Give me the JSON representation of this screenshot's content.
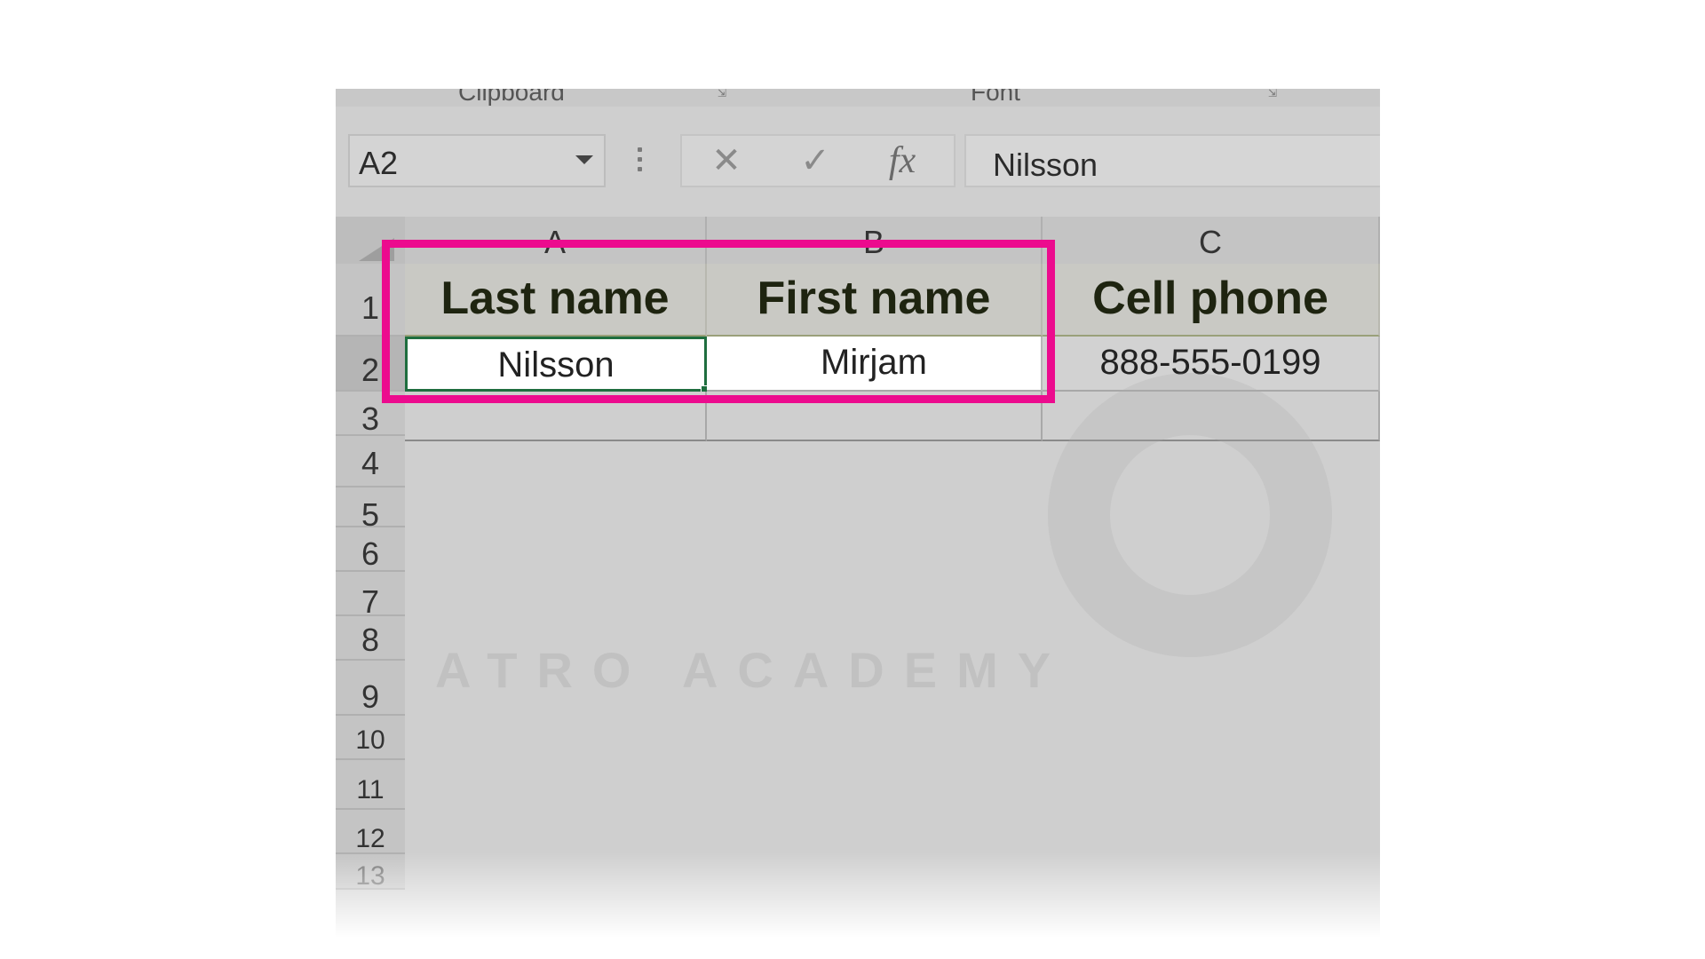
{
  "ribbon": {
    "groups": [
      {
        "label": "Clipboard"
      },
      {
        "label": "Font"
      }
    ]
  },
  "formula_bar": {
    "name_box": "A2",
    "cancel_glyph": "✕",
    "enter_glyph": "✓",
    "fx_label": "fx",
    "value": "Nilsson"
  },
  "sheet": {
    "columns": [
      "A",
      "B",
      "C"
    ],
    "rows": [
      "1",
      "2",
      "3",
      "4",
      "5",
      "6",
      "7",
      "8",
      "9",
      "10",
      "11",
      "12",
      "13"
    ],
    "header_cells": [
      "Last name",
      "First name",
      "Cell phone"
    ],
    "data_cells": [
      "Nilsson",
      "Mirjam",
      "888-555-0199"
    ],
    "active_cell": "A2"
  },
  "watermark": {
    "text": "ATRO ACADEMY"
  },
  "colors": {
    "highlight": "#ec0b8e",
    "selection": "#1f6e3f"
  },
  "icons": {
    "cancel": "close-icon",
    "enter": "check-icon",
    "function": "fx-icon",
    "dropdown": "chevron-down-icon"
  }
}
